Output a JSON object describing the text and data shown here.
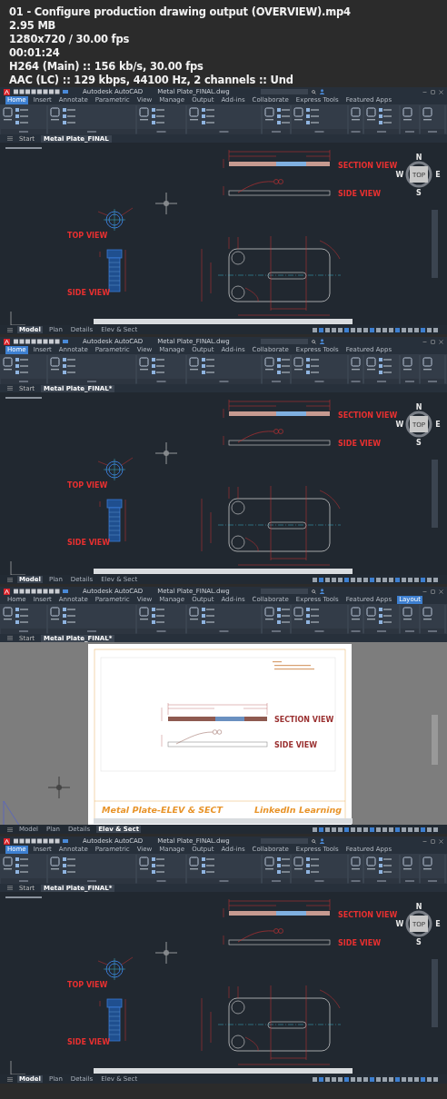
{
  "info": [
    "01 - Configure production drawing output (OVERVIEW).mp4",
    "2.95 MB",
    "1280x720 / 30.00 fps",
    "00:01:24",
    "H264 (Main) :: 156 kb/s, 30.00 fps",
    "AAC (LC) :: 129 kbps, 44100 Hz, 2 channels :: Und"
  ],
  "frames": [
    {
      "kind": "model",
      "app_title": "Autodesk AutoCAD",
      "file_title": "Metal Plate_FINAL.dwg",
      "ribbon_tabs": [
        {
          "label": "Home",
          "selected": true
        },
        {
          "label": "Insert",
          "selected": false
        },
        {
          "label": "Annotate",
          "selected": false
        },
        {
          "label": "Parametric",
          "selected": false
        },
        {
          "label": "View",
          "selected": false
        },
        {
          "label": "Manage",
          "selected": false
        },
        {
          "label": "Output",
          "selected": false
        },
        {
          "label": "Add-ins",
          "selected": false
        },
        {
          "label": "Collaborate",
          "selected": false
        },
        {
          "label": "Express Tools",
          "selected": false
        },
        {
          "label": "Featured Apps",
          "selected": false
        }
      ],
      "file_tabs": [
        {
          "label": "Start",
          "selected": false
        },
        {
          "label": "Metal Plate_FINAL",
          "selected": true
        }
      ],
      "labels": {
        "section": "SECTION VIEW",
        "side": "SIDE VIEW",
        "top": "TOP VIEW",
        "bolt": "SIDE VIEW"
      },
      "viewcube": {
        "north": "N",
        "west": "W",
        "east": "E",
        "south": "S",
        "face": "TOP"
      },
      "layout_tabs": [
        {
          "label": "Model",
          "selected": true
        },
        {
          "label": "Plan",
          "selected": false
        },
        {
          "label": "Details",
          "selected": false
        },
        {
          "label": "Elev & Sect",
          "selected": false
        }
      ]
    },
    {
      "kind": "model",
      "app_title": "Autodesk AutoCAD",
      "file_title": "Metal Plate_FINAL.dwg",
      "ribbon_tabs": [
        {
          "label": "Home",
          "selected": true
        },
        {
          "label": "Insert",
          "selected": false
        },
        {
          "label": "Annotate",
          "selected": false
        },
        {
          "label": "Parametric",
          "selected": false
        },
        {
          "label": "View",
          "selected": false
        },
        {
          "label": "Manage",
          "selected": false
        },
        {
          "label": "Output",
          "selected": false
        },
        {
          "label": "Add-ins",
          "selected": false
        },
        {
          "label": "Collaborate",
          "selected": false
        },
        {
          "label": "Express Tools",
          "selected": false
        },
        {
          "label": "Featured Apps",
          "selected": false
        }
      ],
      "file_tabs": [
        {
          "label": "Start",
          "selected": false
        },
        {
          "label": "Metal Plate_FINAL*",
          "selected": true
        }
      ],
      "labels": {
        "section": "SECTION VIEW",
        "side": "SIDE VIEW",
        "top": "TOP VIEW",
        "bolt": "SIDE VIEW"
      },
      "viewcube": {
        "north": "N",
        "west": "W",
        "east": "E",
        "south": "S",
        "face": "TOP"
      },
      "layout_tabs": [
        {
          "label": "Model",
          "selected": true
        },
        {
          "label": "Plan",
          "selected": false
        },
        {
          "label": "Details",
          "selected": false
        },
        {
          "label": "Elev & Sect",
          "selected": false
        }
      ]
    },
    {
      "kind": "layout",
      "app_title": "Autodesk AutoCAD",
      "file_title": "Metal Plate_FINAL.dwg",
      "ribbon_tabs": [
        {
          "label": "Home",
          "selected": false
        },
        {
          "label": "Insert",
          "selected": false
        },
        {
          "label": "Annotate",
          "selected": false
        },
        {
          "label": "Parametric",
          "selected": false
        },
        {
          "label": "View",
          "selected": false
        },
        {
          "label": "Manage",
          "selected": false
        },
        {
          "label": "Output",
          "selected": false
        },
        {
          "label": "Add-ins",
          "selected": false
        },
        {
          "label": "Collaborate",
          "selected": false
        },
        {
          "label": "Express Tools",
          "selected": false
        },
        {
          "label": "Featured Apps",
          "selected": false
        },
        {
          "label": "Layout",
          "selected": true
        }
      ],
      "file_tabs": [
        {
          "label": "Start",
          "selected": false
        },
        {
          "label": "Metal Plate_FINAL*",
          "selected": true
        }
      ],
      "sheet": {
        "section": "SECTION VIEW",
        "side": "SIDE VIEW",
        "title": "Metal Plate-ELEV & SECT",
        "company": "LinkedIn Learning"
      },
      "layout_tabs": [
        {
          "label": "Model",
          "selected": false
        },
        {
          "label": "Plan",
          "selected": false
        },
        {
          "label": "Details",
          "selected": false
        },
        {
          "label": "Elev & Sect",
          "selected": true
        }
      ]
    },
    {
      "kind": "model",
      "app_title": "Autodesk AutoCAD",
      "file_title": "Metal Plate_FINAL.dwg",
      "ribbon_tabs": [
        {
          "label": "Home",
          "selected": true
        },
        {
          "label": "Insert",
          "selected": false
        },
        {
          "label": "Annotate",
          "selected": false
        },
        {
          "label": "Parametric",
          "selected": false
        },
        {
          "label": "View",
          "selected": false
        },
        {
          "label": "Manage",
          "selected": false
        },
        {
          "label": "Output",
          "selected": false
        },
        {
          "label": "Add-ins",
          "selected": false
        },
        {
          "label": "Collaborate",
          "selected": false
        },
        {
          "label": "Express Tools",
          "selected": false
        },
        {
          "label": "Featured Apps",
          "selected": false
        }
      ],
      "file_tabs": [
        {
          "label": "Start",
          "selected": false
        },
        {
          "label": "Metal Plate_FINAL*",
          "selected": true
        }
      ],
      "labels": {
        "section": "SECTION VIEW",
        "side": "SIDE VIEW",
        "top": "TOP VIEW",
        "bolt": "SIDE VIEW"
      },
      "viewcube": {
        "north": "N",
        "west": "W",
        "east": "E",
        "south": "S",
        "face": "TOP"
      },
      "layout_tabs": [
        {
          "label": "Model",
          "selected": true
        },
        {
          "label": "Plan",
          "selected": false
        },
        {
          "label": "Details",
          "selected": false
        },
        {
          "label": "Elev & Sect",
          "selected": false
        }
      ]
    }
  ]
}
